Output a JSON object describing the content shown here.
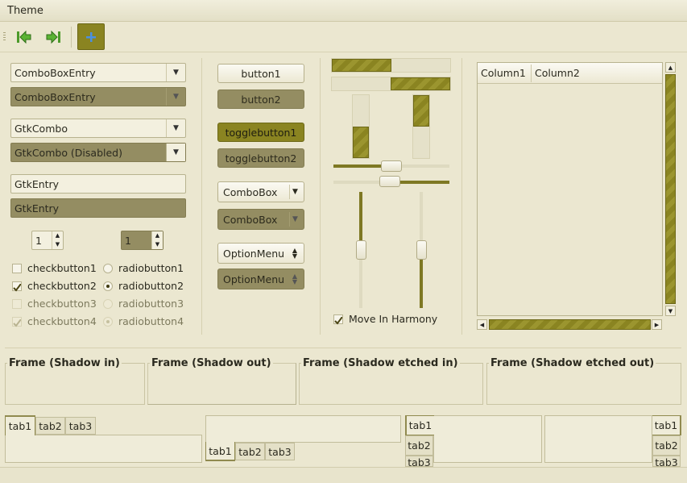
{
  "menu": {
    "theme": "Theme"
  },
  "toolbar": {
    "back_icon": "go-first-icon",
    "forward_icon": "go-last-icon",
    "add_icon": "add-icon"
  },
  "left": {
    "combo_entry_1": "ComboBoxEntry",
    "combo_entry_2": "ComboBoxEntry",
    "gtk_combo_1": "GtkCombo",
    "gtk_combo_2": "GtkCombo (Disabled)",
    "entry_1": "GtkEntry",
    "entry_2": "GtkEntry",
    "spin_1": "1",
    "spin_2": "1",
    "checks": [
      "checkbutton1",
      "checkbutton2",
      "checkbutton3",
      "checkbutton4"
    ],
    "radios": [
      "radiobutton1",
      "radiobutton2",
      "radiobutton3",
      "radiobutton4"
    ]
  },
  "buttons": {
    "button1": "button1",
    "button2": "button2",
    "toggle1": "togglebutton1",
    "toggle2": "togglebutton2",
    "combobox1": "ComboBox",
    "combobox2": "ComboBox",
    "option1": "OptionMenu",
    "option2": "OptionMenu"
  },
  "progress": {
    "h1": 0.5,
    "h2": 0.5,
    "v1": 0.5,
    "v2": 0.5,
    "hscale1": 0.5,
    "hscale2": 0.5,
    "vscale1": 0.5,
    "vscale2": 0.5,
    "harmony": "Move In Harmony"
  },
  "tree": {
    "col1": "Column1",
    "col2": "Column2"
  },
  "frames": [
    "Frame (Shadow in)",
    "Frame (Shadow out)",
    "Frame (Shadow etched in)",
    "Frame (Shadow etched out)"
  ],
  "tabs": [
    "tab1",
    "tab2",
    "tab3"
  ],
  "colors": {
    "accent": "#8a8421",
    "background": "#ebe7d0",
    "disabled": "#948d62"
  }
}
